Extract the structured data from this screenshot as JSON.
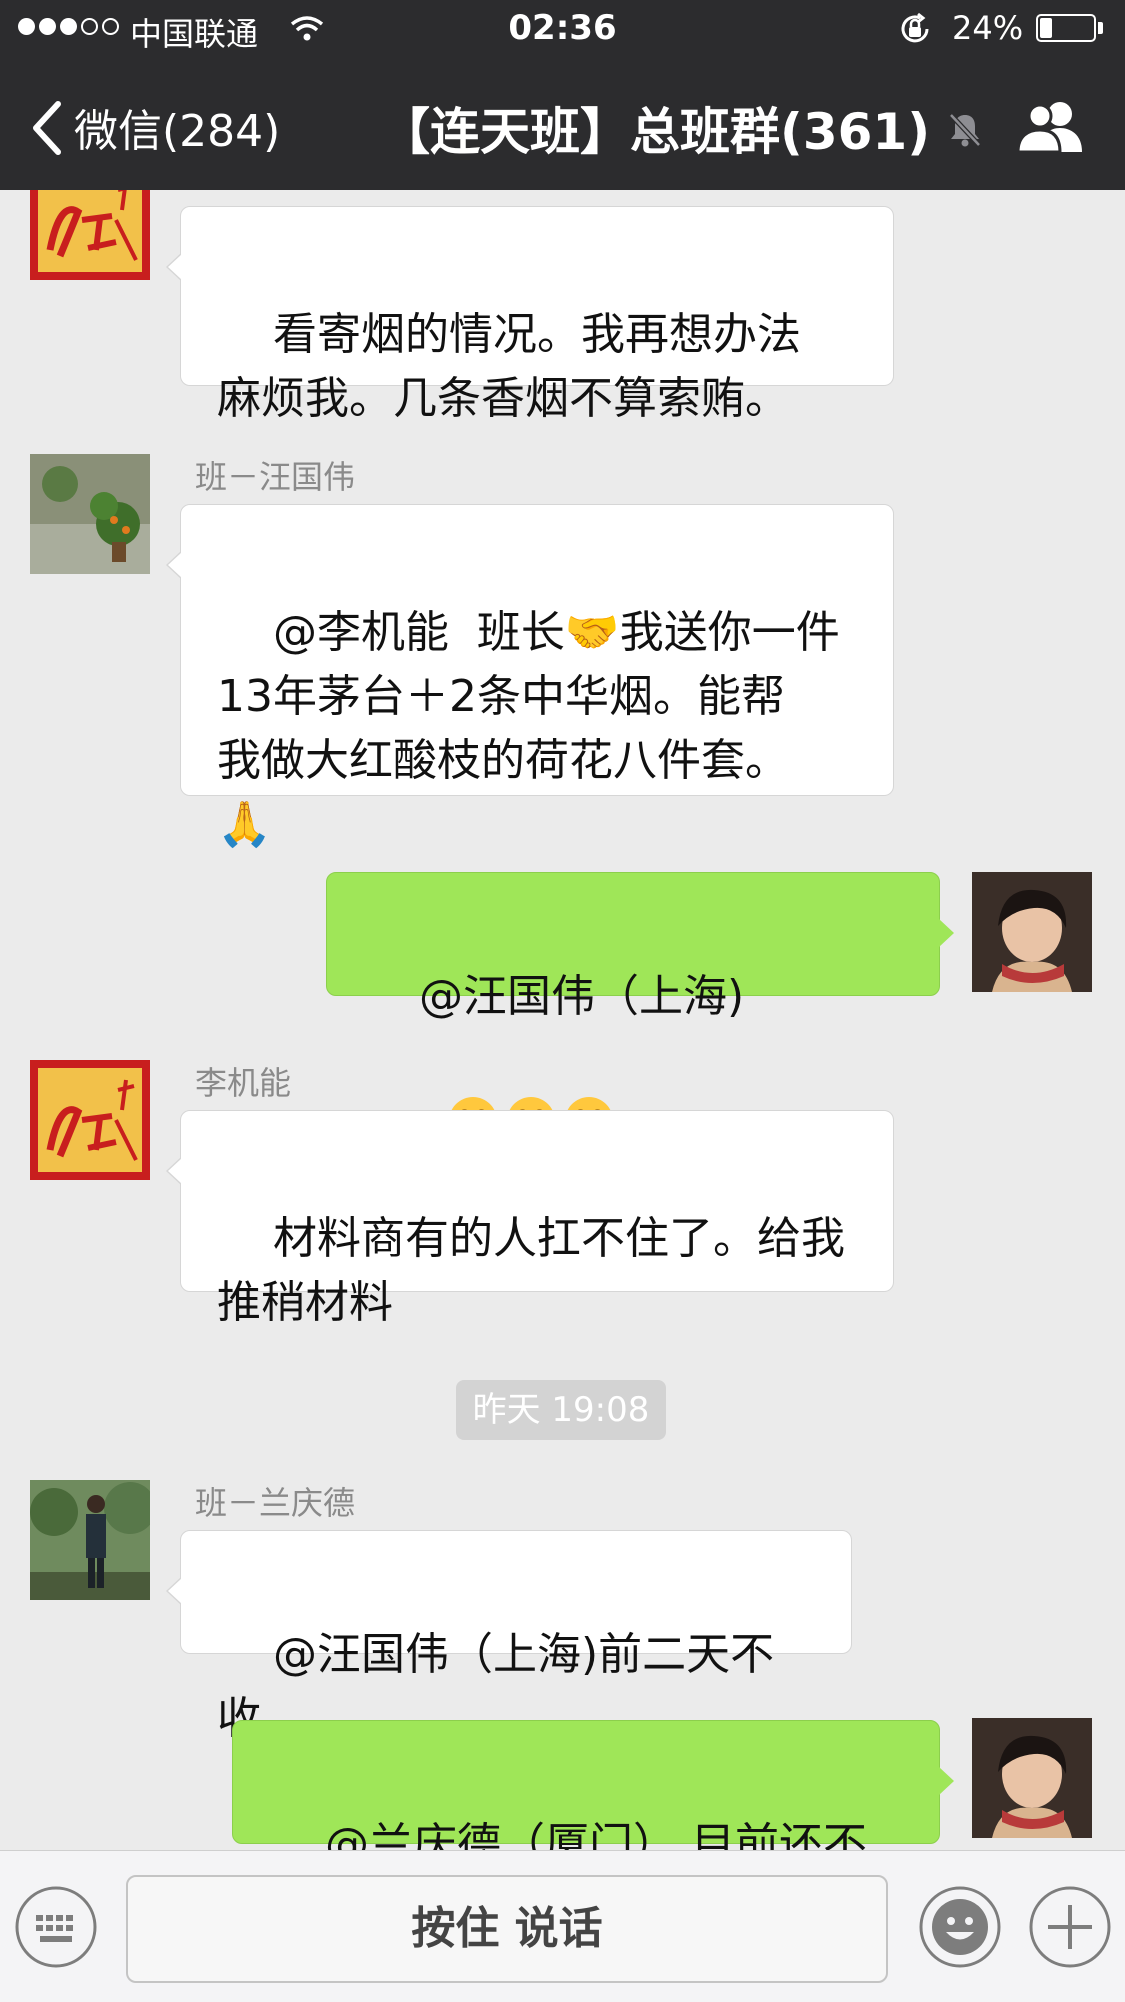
{
  "status_bar": {
    "carrier": "中国联通",
    "time": "02:36",
    "battery_percent": "24%",
    "battery_level": 0.24,
    "signal_bars_filled": 3,
    "signal_bars_total": 5
  },
  "nav": {
    "back_label": "微信(284)",
    "title": "【连天班】总班群(361)",
    "icons": [
      "chevron-left-icon",
      "mute-icon",
      "group-members-icon"
    ]
  },
  "messages": [
    {
      "side": "left",
      "sender": "",
      "text": "看寄烟的情况。我再想办法\n麻烦我。几条香烟不算索贿。"
    },
    {
      "side": "left",
      "sender": "班－汪国伟",
      "text": "@李机能  班长🤝我送你一件\n13年茅台＋2条中华烟。能帮\n我做大红酸枝的荷花八件套。\n🙏"
    },
    {
      "side": "right",
      "sender": "",
      "text": "@汪国伟（上海)",
      "emoji_count": 3,
      "emoji_icon": "crying-face-icon"
    },
    {
      "side": "left",
      "sender": "李机能",
      "text": "材料商有的人扛不住了。给我\n推稍材料"
    },
    {
      "side": "left",
      "sender": "班－兰庆德",
      "text": "@汪国伟（上海)前二天不收"
    },
    {
      "side": "right",
      "sender": "",
      "text": "@兰庆德（厦门） 目前还不收"
    }
  ],
  "timestamp": "昨天 19:08",
  "input_bar": {
    "talk_label": "按住 说话",
    "icons": [
      "keyboard-icon",
      "emoji-icon",
      "plus-icon"
    ]
  },
  "colors": {
    "nav_background": "#2c2c2e",
    "chat_background": "#ebebeb",
    "self_bubble": "#9fe658",
    "other_bubble": "#ffffff"
  }
}
